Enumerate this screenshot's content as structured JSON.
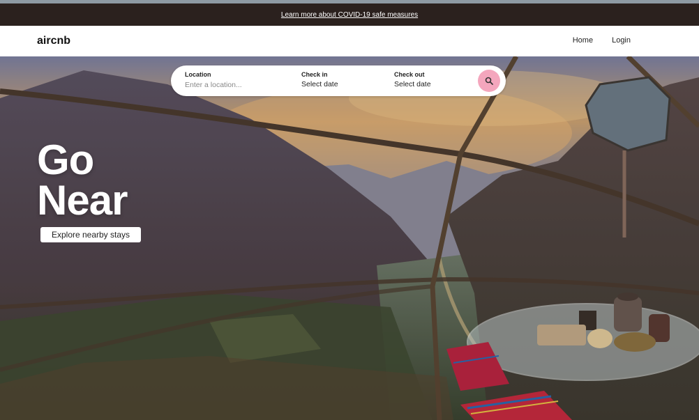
{
  "banner": {
    "covid_link": "Learn more about COVID-19 safe measures"
  },
  "header": {
    "logo": "aircnb",
    "nav": {
      "home": "Home",
      "login": "Login"
    }
  },
  "search": {
    "location_label": "Location",
    "location_placeholder": "Enter a location...",
    "checkin_label": "Check in",
    "checkin_value": "Select date",
    "checkout_label": "Check out",
    "checkout_value": "Select date",
    "button_icon": "search-icon"
  },
  "hero": {
    "headline_line1": "Go",
    "headline_line2": "Near",
    "cta": "Explore nearby stays"
  },
  "colors": {
    "banner_bg": "#2b211e",
    "search_button": "#f4a6bd",
    "navbar_bg": "#ffffff"
  }
}
